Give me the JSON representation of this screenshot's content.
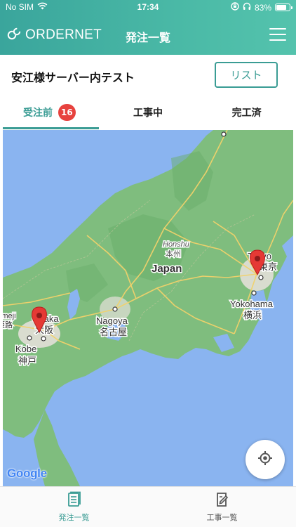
{
  "status_bar": {
    "carrier": "No SIM",
    "time": "17:34",
    "battery": "83%",
    "battery_level": 0.83
  },
  "header": {
    "brand": "ORDERNET",
    "title": "発注一覧",
    "menu_icon": "hamburger-icon"
  },
  "subbar": {
    "title": "安江様サーバー内テスト",
    "list_button": "リスト"
  },
  "tabs": [
    {
      "label": "受注前",
      "badge": "16",
      "active": true
    },
    {
      "label": "工事中",
      "active": false
    },
    {
      "label": "完工済",
      "active": false
    }
  ],
  "map": {
    "labels": {
      "honshu_en": "Honshu",
      "honshu_jp": "本州",
      "japan": "Japan",
      "tokyo": "Tokyo",
      "tokyo_jp": "東京",
      "yokohama": "Yokohama",
      "yokohama_jp": "横浜",
      "nagoya": "Nagoya",
      "nagoya_jp": "名古屋",
      "osaka": "Osaka",
      "osaka_jp": "大阪",
      "kobe": "Kobe",
      "kobe_jp": "神戸",
      "himeji": "Himeji",
      "himeji_jp": "姫路"
    },
    "attribution": "Google",
    "pins": [
      "osaka-pin",
      "tokyo-pin"
    ]
  },
  "bottom_nav": [
    {
      "label": "発注一覧",
      "icon": "document-list-icon",
      "active": true
    },
    {
      "label": "工事一覧",
      "icon": "edit-document-icon",
      "active": false
    }
  ],
  "colors": {
    "accent": "#3a9c94",
    "badge": "#e7423e",
    "pin": "#e53935",
    "sea": "#8ab4f0",
    "land": "#7fbd7e"
  }
}
